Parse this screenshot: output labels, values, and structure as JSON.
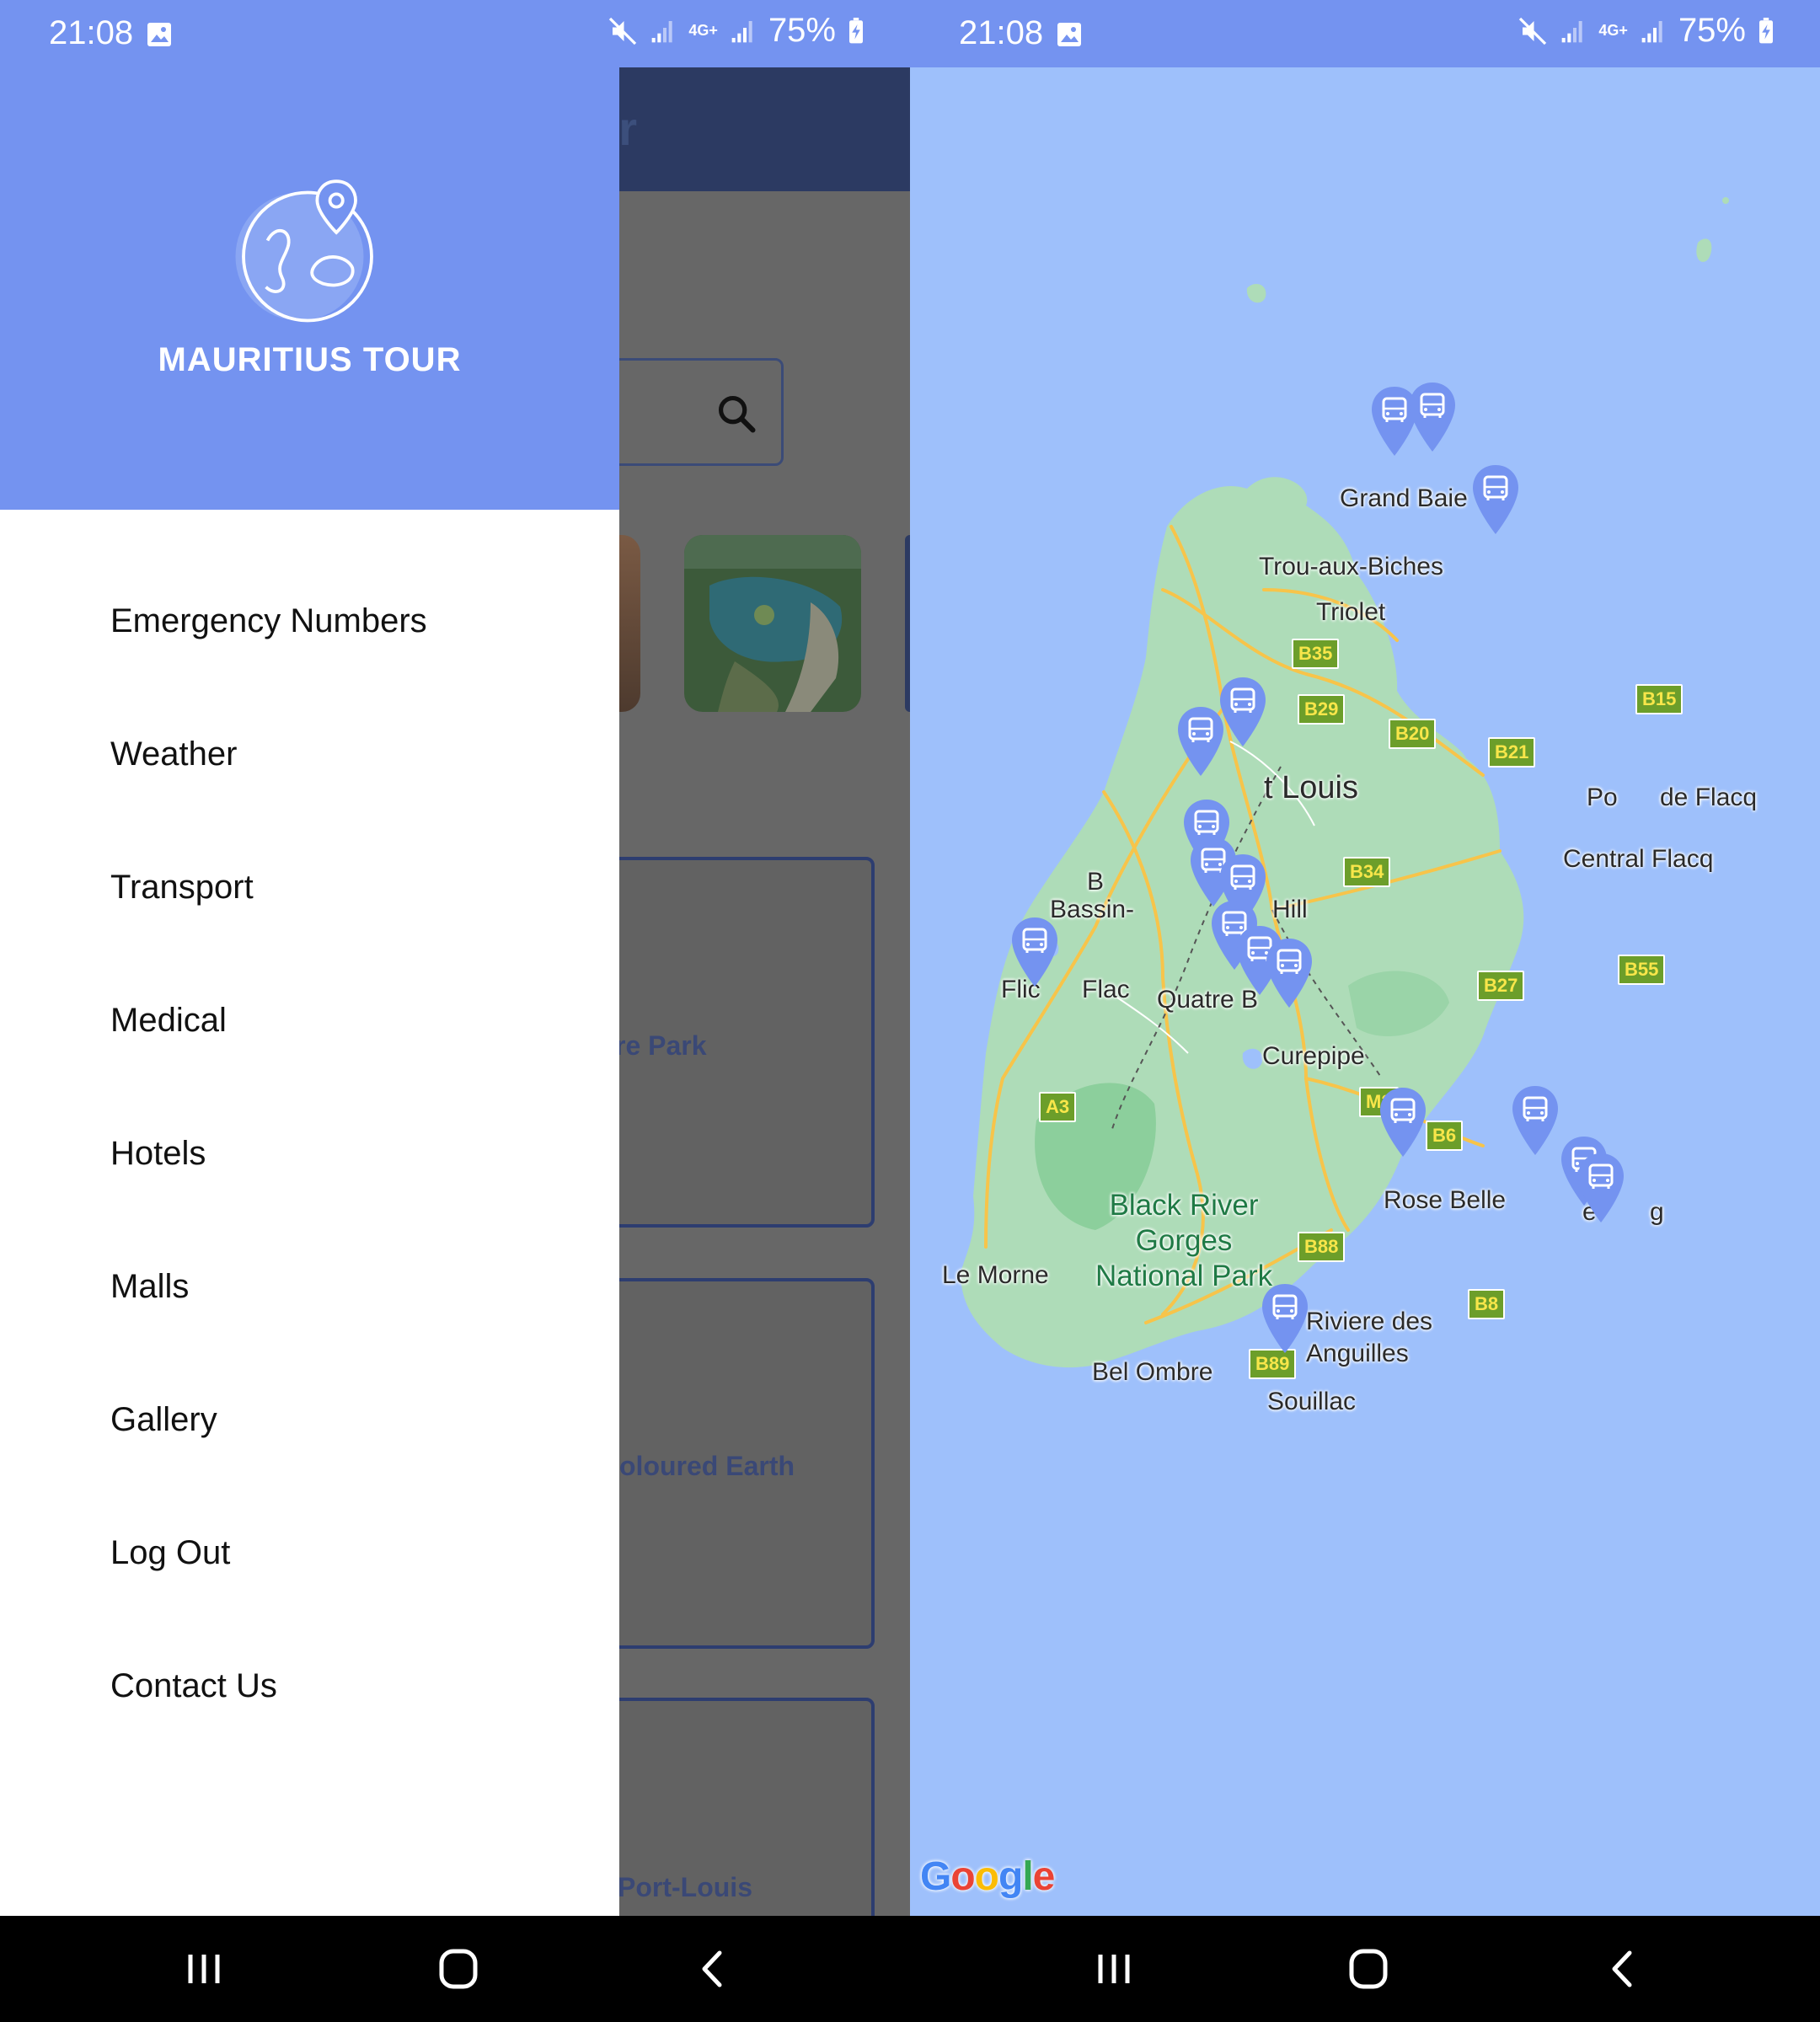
{
  "status": {
    "time": "21:08",
    "network": "4G+",
    "battery": "75%"
  },
  "left_screen": {
    "app": {
      "title_fragment": "ur",
      "card_titles": [
        "re Park",
        "oloured Earth",
        "Port-Louis"
      ]
    },
    "drawer": {
      "title": "MAURITIUS TOUR",
      "menu": [
        "Emergency Numbers",
        "Weather",
        "Transport",
        "Medical",
        "Hotels",
        "Malls",
        "Gallery",
        "Log Out",
        "Contact Us"
      ]
    }
  },
  "right_screen": {
    "map": {
      "attribution": "Google",
      "place_labels": {
        "grand_baie": "Grand Baie",
        "trou_aux_biches": "Trou-aux-Biches",
        "triolet": "Triolet",
        "port_louis": "t Louis",
        "pointe_de_flacq": "Po",
        "pointe_de_flacq_2": "de Flacq",
        "central_flacq": "Central Flacq",
        "bassin": "Bassin-",
        "hill": "Hill",
        "b": "B",
        "flic": "Flic",
        "flac": "Flac",
        "quatre": "Quatre B",
        "curepipe": "Curepipe",
        "rose_belle": "Rose Belle",
        "mahebourg_1": "e",
        "mahebourg_2": "g",
        "black_river": "Black River\nGorges\nNational Park",
        "le_morne": "Le Morne",
        "riviere": "Riviere des\nAnguilles",
        "bel_ombre": "Bel Ombre",
        "souillac": "Souillac"
      },
      "road_badges": [
        "B35",
        "B29",
        "B20",
        "B21",
        "B15",
        "B34",
        "B55",
        "B27",
        "A3",
        "M2",
        "B6",
        "B88",
        "B8",
        "B89"
      ],
      "pin_icon": "bus-icon"
    }
  },
  "colors": {
    "header_blue": "#7493f0",
    "app_navy": "#2c3a62",
    "sea": "#9ec0fb",
    "land": "#aedcb8",
    "pin": "#7493f0"
  }
}
